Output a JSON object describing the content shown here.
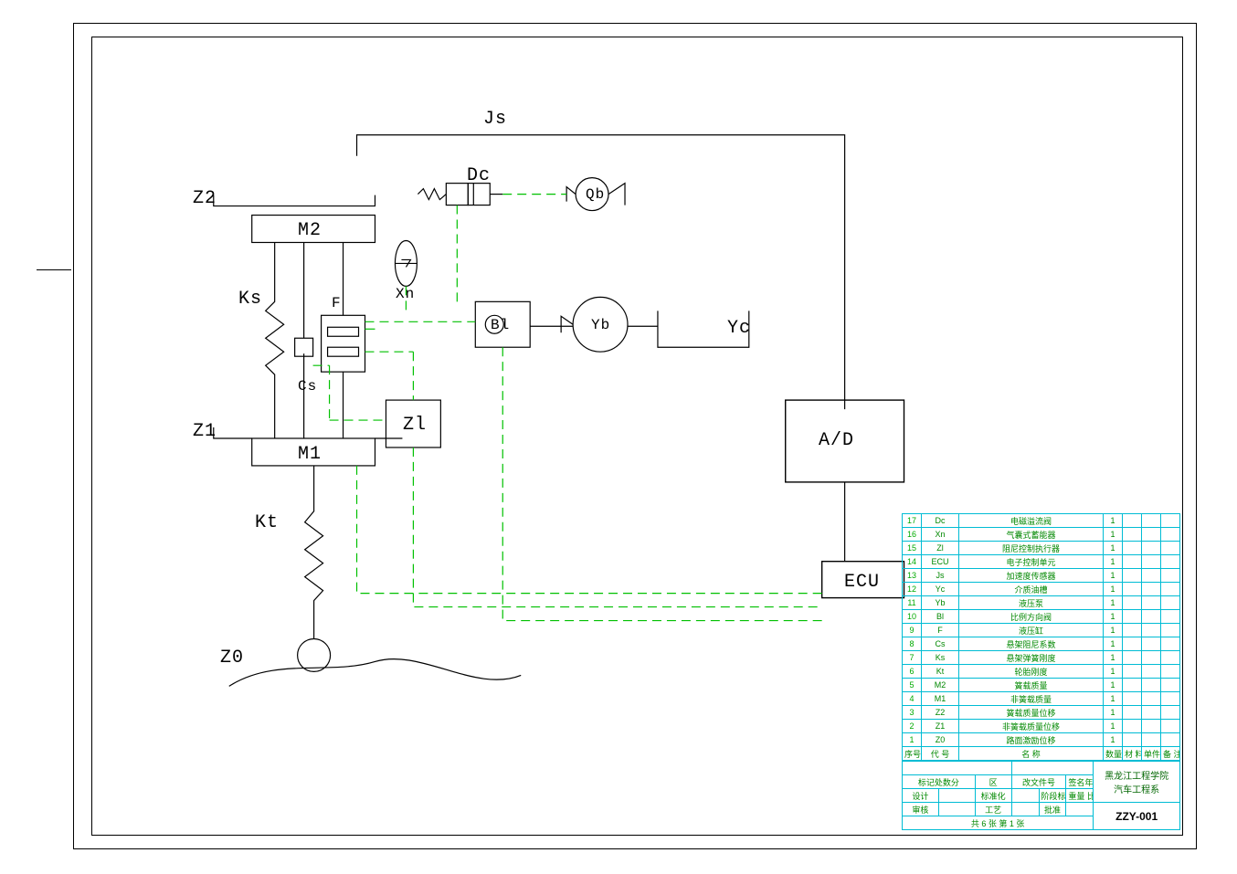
{
  "labels": {
    "Js": "Js",
    "Z2": "Z2",
    "M2": "M2",
    "Ks": "Ks",
    "F": "F",
    "Cs": "Cs",
    "Z1": "Z1",
    "M1": "M1",
    "Zl": "Zl",
    "Kt": "Kt",
    "Z0": "Z0",
    "Dc": "Dc",
    "Xn": "Xn",
    "Qb": "Qb",
    "Bl": "Bl",
    "Yb": "Yb",
    "Yc": "Yc",
    "AD": "A/D",
    "ECU": "ECU"
  },
  "bom_header": {
    "c1": "序号",
    "c2": "代    号",
    "c3": "名        称",
    "c4": "数量",
    "c5": "材    料",
    "c6": "单件总计\n重量",
    "c7": "备 注"
  },
  "bom": [
    {
      "n": "17",
      "code": "Dc",
      "name": "电磁溢流阀",
      "qty": "1"
    },
    {
      "n": "16",
      "code": "Xn",
      "name": "气囊式蓄能器",
      "qty": "1"
    },
    {
      "n": "15",
      "code": "Zl",
      "name": "阻尼控制执行器",
      "qty": "1"
    },
    {
      "n": "14",
      "code": "ECU",
      "name": "电子控制单元",
      "qty": "1"
    },
    {
      "n": "13",
      "code": "Js",
      "name": "加速度传感器",
      "qty": "1"
    },
    {
      "n": "12",
      "code": "Yc",
      "name": "介质油槽",
      "qty": "1"
    },
    {
      "n": "11",
      "code": "Yb",
      "name": "液压泵",
      "qty": "1"
    },
    {
      "n": "10",
      "code": "Bl",
      "name": "比例方向阀",
      "qty": "1"
    },
    {
      "n": "9",
      "code": "F",
      "name": "液压缸",
      "qty": "1"
    },
    {
      "n": "8",
      "code": "Cs",
      "name": "悬架阻尼系数",
      "qty": "1"
    },
    {
      "n": "7",
      "code": "Ks",
      "name": "悬架弹簧刚度",
      "qty": "1"
    },
    {
      "n": "6",
      "code": "Kt",
      "name": "轮胎刚度",
      "qty": "1"
    },
    {
      "n": "5",
      "code": "M2",
      "name": "簧载质量",
      "qty": "1"
    },
    {
      "n": "4",
      "code": "M1",
      "name": "非簧载质量",
      "qty": "1"
    },
    {
      "n": "3",
      "code": "Z2",
      "name": "簧载质量位移",
      "qty": "1"
    },
    {
      "n": "2",
      "code": "Z1",
      "name": "非簧载质量位移",
      "qty": "1"
    },
    {
      "n": "1",
      "code": "Z0",
      "name": "路面激励位移",
      "qty": "1"
    }
  ],
  "tb_bottom": {
    "mark_row": {
      "a": "标记处数分",
      "b": "区",
      "c": "改文件号",
      "d": "签名年.月.日"
    },
    "design": "设计",
    "std": "标准化",
    "tol_label": "阶段标记",
    "wt": "重量",
    "scale": "比例",
    "sheets": "共 6 张  第 1 张",
    "auditor": "审核",
    "process": "工艺",
    "approve": "批准",
    "org1": "黑龙江工程学院",
    "org2": "汽车工程系",
    "code": "ZZY-001"
  }
}
